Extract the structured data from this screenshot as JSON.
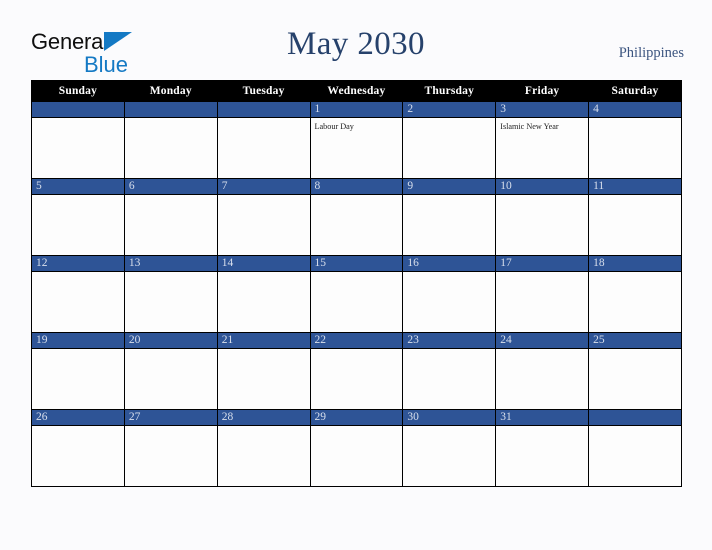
{
  "brand": {
    "name_part1": "General",
    "name_part2": "Blue",
    "triangle_icon": "triangle-icon",
    "accent_color": "#1479c4"
  },
  "header": {
    "title": "May 2030",
    "country": "Philippines",
    "title_color": "#26416b"
  },
  "calendar": {
    "month": "May",
    "year": "2030",
    "weekday_headers": [
      "Sunday",
      "Monday",
      "Tuesday",
      "Wednesday",
      "Thursday",
      "Friday",
      "Saturday"
    ],
    "header_bg": "#000000",
    "daynum_bg": "#2e5496",
    "daynum_color": "#d8dfec",
    "weeks": [
      [
        {
          "day": "",
          "events": []
        },
        {
          "day": "",
          "events": []
        },
        {
          "day": "",
          "events": []
        },
        {
          "day": "1",
          "events": [
            "Labour Day"
          ]
        },
        {
          "day": "2",
          "events": []
        },
        {
          "day": "3",
          "events": [
            "Islamic New Year"
          ]
        },
        {
          "day": "4",
          "events": []
        }
      ],
      [
        {
          "day": "5",
          "events": []
        },
        {
          "day": "6",
          "events": []
        },
        {
          "day": "7",
          "events": []
        },
        {
          "day": "8",
          "events": []
        },
        {
          "day": "9",
          "events": []
        },
        {
          "day": "10",
          "events": []
        },
        {
          "day": "11",
          "events": []
        }
      ],
      [
        {
          "day": "12",
          "events": []
        },
        {
          "day": "13",
          "events": []
        },
        {
          "day": "14",
          "events": []
        },
        {
          "day": "15",
          "events": []
        },
        {
          "day": "16",
          "events": []
        },
        {
          "day": "17",
          "events": []
        },
        {
          "day": "18",
          "events": []
        }
      ],
      [
        {
          "day": "19",
          "events": []
        },
        {
          "day": "20",
          "events": []
        },
        {
          "day": "21",
          "events": []
        },
        {
          "day": "22",
          "events": []
        },
        {
          "day": "23",
          "events": []
        },
        {
          "day": "24",
          "events": []
        },
        {
          "day": "25",
          "events": []
        }
      ],
      [
        {
          "day": "26",
          "events": []
        },
        {
          "day": "27",
          "events": []
        },
        {
          "day": "28",
          "events": []
        },
        {
          "day": "29",
          "events": []
        },
        {
          "day": "30",
          "events": []
        },
        {
          "day": "31",
          "events": []
        },
        {
          "day": "",
          "events": []
        }
      ]
    ]
  }
}
